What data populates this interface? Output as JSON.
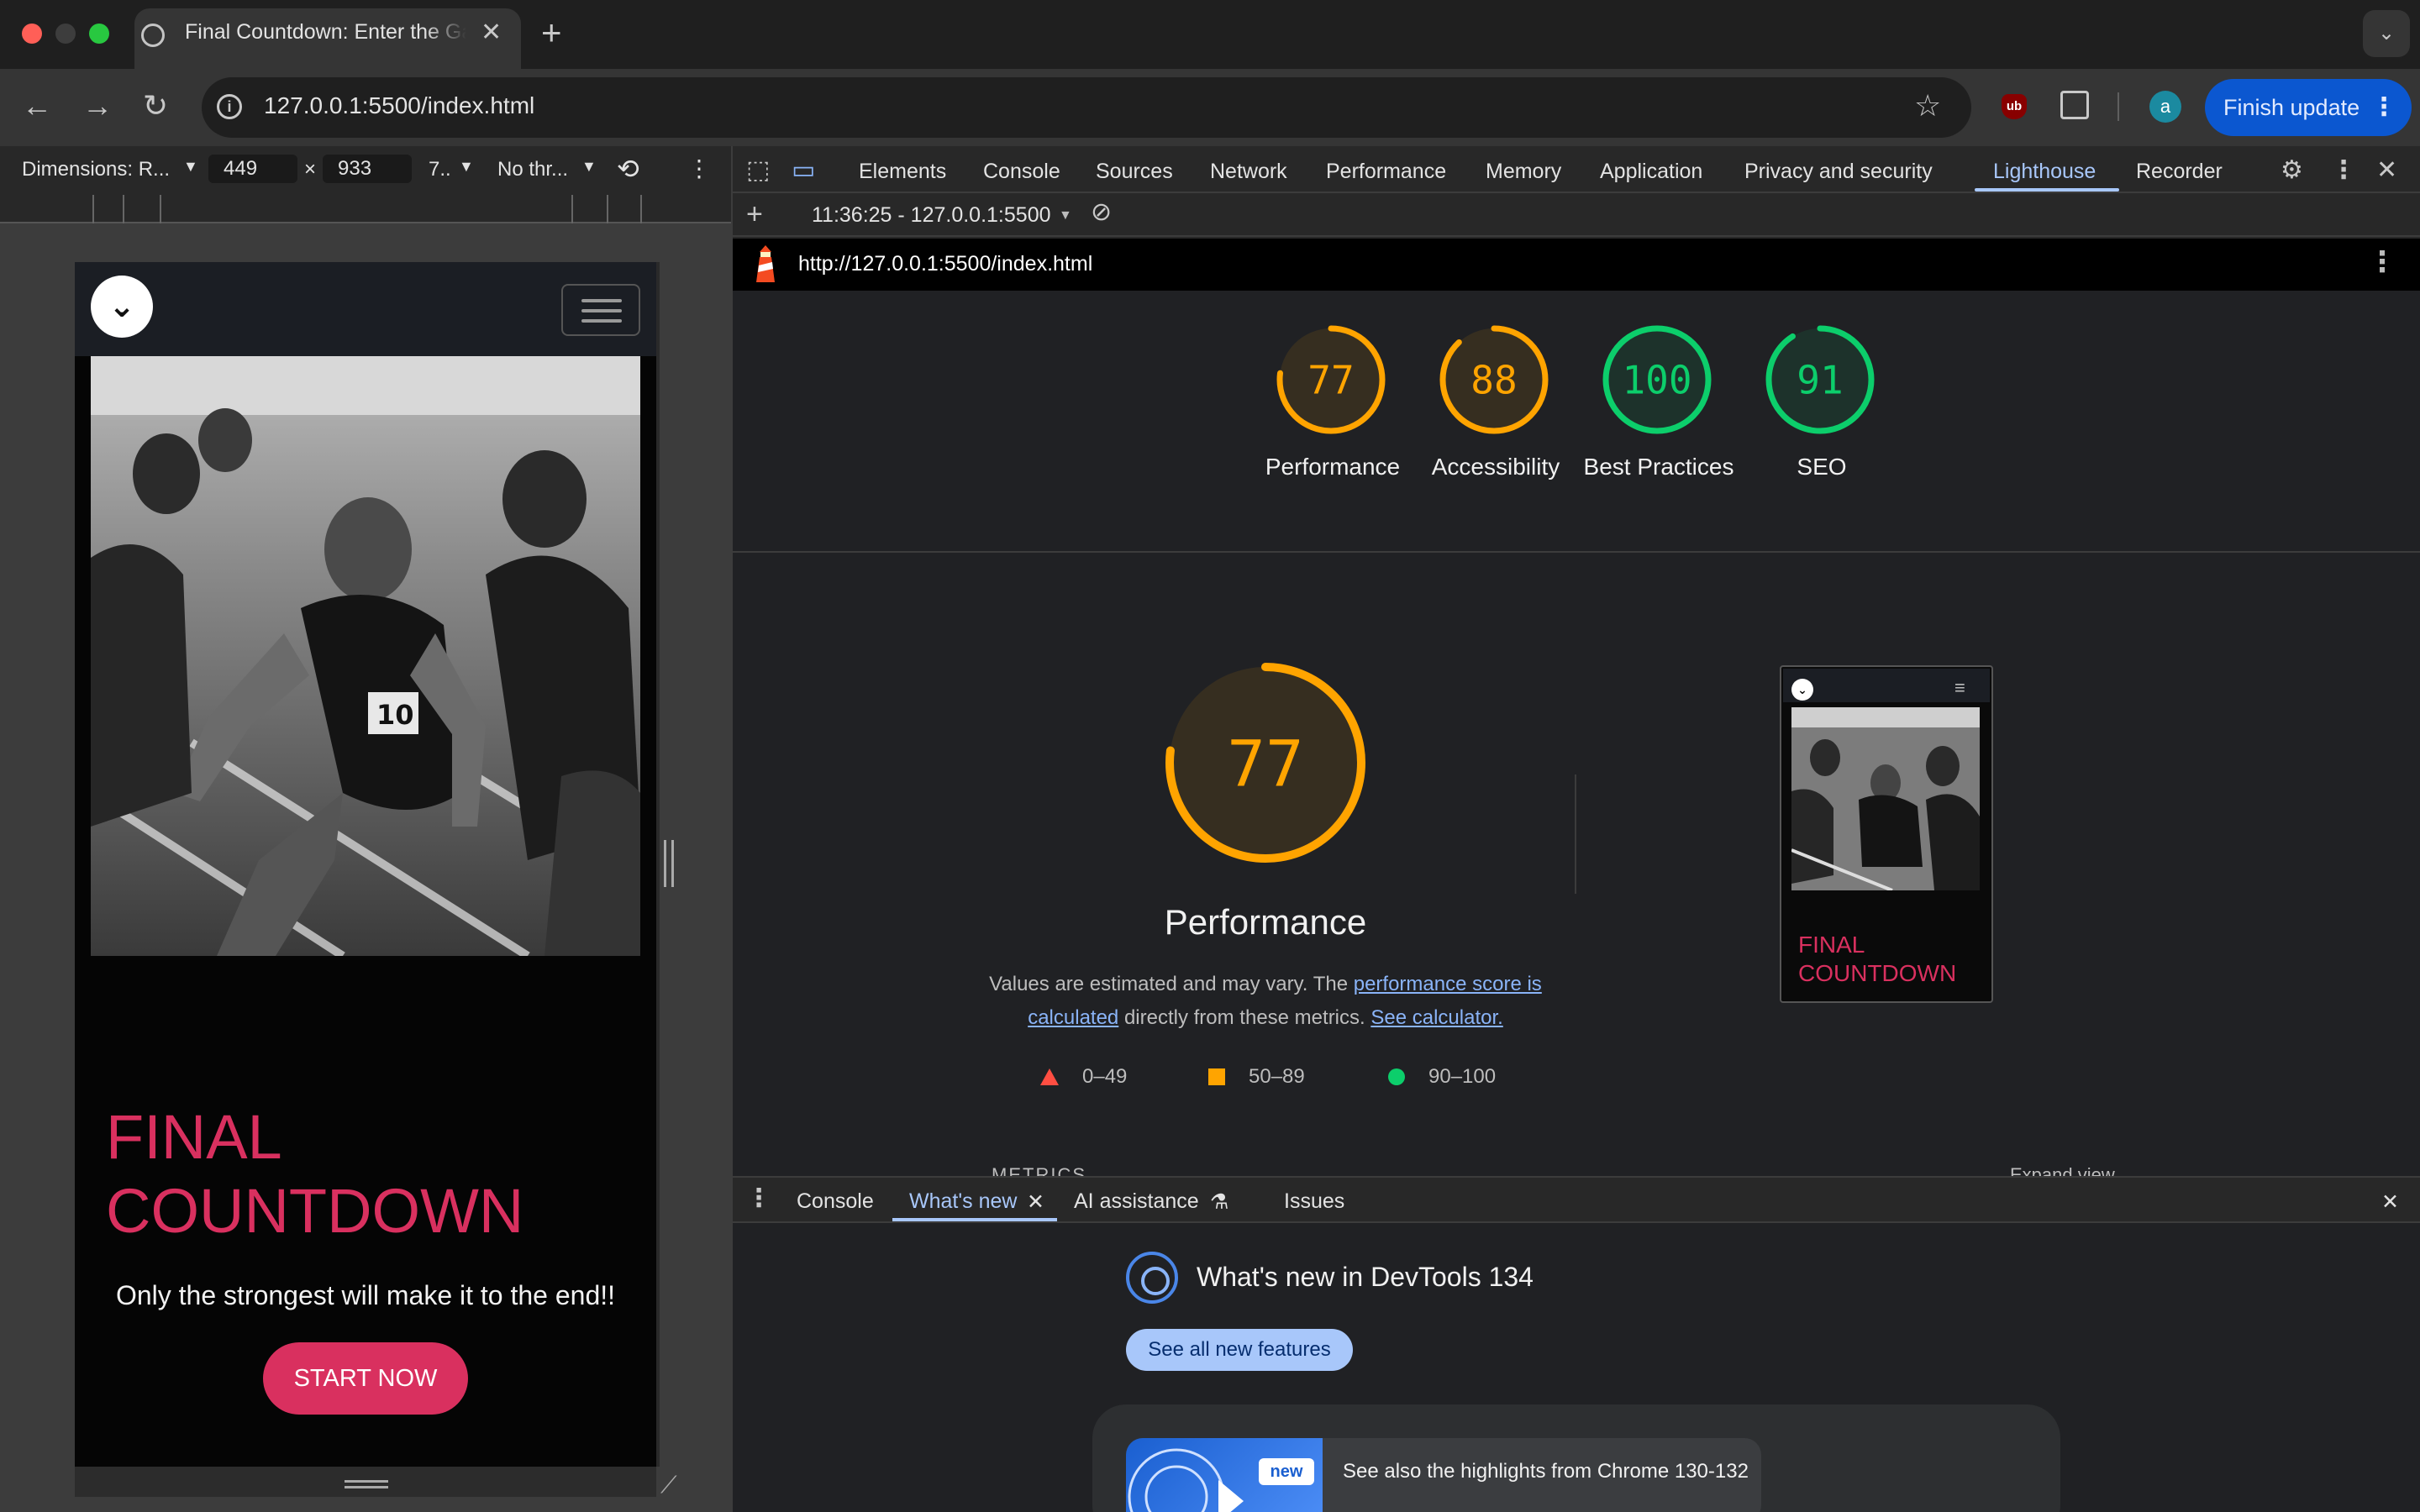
{
  "browser": {
    "tab_title": "Final Countdown: Enter the Game",
    "tab_close": "✕",
    "new_tab": "+",
    "url": "127.0.0.1:5500/index.html",
    "finish_update": "Finish update",
    "avatar_letter": "a",
    "ublock_badge": "ub"
  },
  "device_toolbar": {
    "dimensions_label": "Dimensions: R...",
    "width": "449",
    "times": "×",
    "height": "933",
    "zoom": "7..",
    "throttle": "No thr...",
    "more": "⋮"
  },
  "mobile_page": {
    "title_line1": "FINAL",
    "title_line2": "COUNTDOWN",
    "subtitle": "Only the strongest will make it to the end!!",
    "cta": "START NOW",
    "accent_color": "#d9305f"
  },
  "devtools": {
    "tabs": [
      "Elements",
      "Console",
      "Sources",
      "Network",
      "Performance",
      "Memory",
      "Application",
      "Privacy and security",
      "Lighthouse",
      "Recorder"
    ],
    "active_tab": "Lighthouse",
    "report_selector": "11:36:25 - 127.0.0.1:5500",
    "report_url": "http://127.0.0.1:5500/index.html"
  },
  "lighthouse": {
    "scores": [
      {
        "label": "Performance",
        "value": "77",
        "score": 77,
        "status": "average"
      },
      {
        "label": "Accessibility",
        "value": "88",
        "score": 88,
        "status": "average"
      },
      {
        "label": "Best Practices",
        "value": "100",
        "score": 100,
        "status": "pass"
      },
      {
        "label": "SEO",
        "value": "91",
        "score": 91,
        "status": "pass"
      }
    ],
    "colors": {
      "average": "#ffa400",
      "pass": "#0cce6b",
      "fail": "#ff4e42"
    },
    "main_score": "77",
    "main_score_value": 77,
    "main_title": "Performance",
    "desc_before": "Values are estimated and may vary. The ",
    "desc_link1": "performance score is calculated",
    "desc_middle": " directly from these metrics. ",
    "desc_link2": "See calculator.",
    "legend": [
      {
        "label": "0–49",
        "shape": "triangle"
      },
      {
        "label": "50–89",
        "shape": "square"
      },
      {
        "label": "90–100",
        "shape": "circle"
      }
    ],
    "thumb_title_line1": "FINAL",
    "thumb_title_line2": "COUNTDOWN",
    "metrics_peek": "METRICS",
    "expand_peek": "Expand view"
  },
  "drawer": {
    "tabs": [
      "Console",
      "What's new",
      "AI assistance",
      "Issues"
    ],
    "active_tab": "What's new",
    "whats_new_title": "What's new in DevTools 134",
    "see_all": "See all new features",
    "new_badge": "new",
    "highlights": "See also the highlights from Chrome 130-132"
  }
}
